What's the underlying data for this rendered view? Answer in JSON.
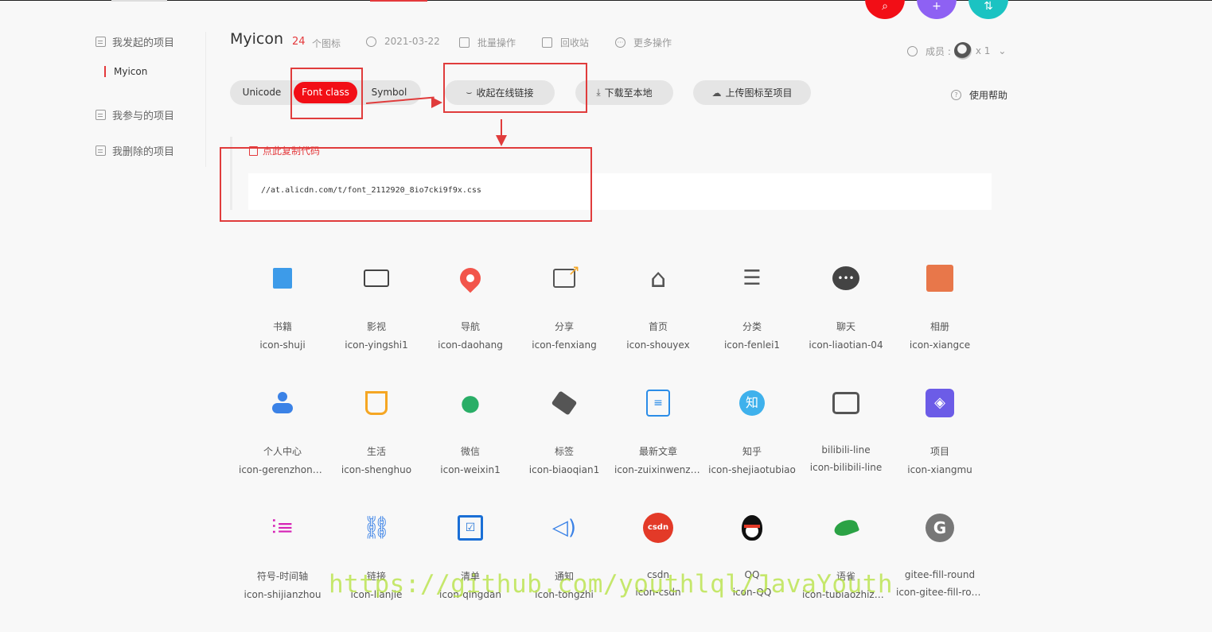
{
  "sidebar": {
    "items": [
      {
        "label": "我发起的项目"
      },
      {
        "label": "我参与的项目"
      },
      {
        "label": "我删除的项目"
      }
    ],
    "active_project": "Myicon"
  },
  "header": {
    "title": "Myicon",
    "icon_count": "24",
    "icon_count_label": "个图标",
    "date": "2021-03-22",
    "batch": "批量操作",
    "trash": "回收站",
    "more": "更多操作",
    "members_label": "成员 :",
    "members_count": "x 1"
  },
  "fabs": {
    "search": "⌕",
    "add": "+",
    "sort": "⇅"
  },
  "tabs": [
    {
      "label": "Unicode",
      "active": false
    },
    {
      "label": "Font class",
      "active": true
    },
    {
      "label": "Symbol",
      "active": false
    }
  ],
  "actions": {
    "collapse": "收起在线链接",
    "download": "下载至本地",
    "upload": "上传图标至项目",
    "help": "使用帮助"
  },
  "code": {
    "copy_label": "点此复制代码",
    "url": "//at.alicdn.com/t/font_2112920_8io7cki9f9x.css"
  },
  "icons": [
    {
      "name": "书籍",
      "cls": "icon-shuji",
      "color": "#3d9be9",
      "glyph": "book-icon"
    },
    {
      "name": "影视",
      "cls": "icon-yingshi1",
      "color": "#444444",
      "glyph": "camera-icon"
    },
    {
      "name": "导航",
      "cls": "icon-daohang",
      "color": "#f2554b",
      "glyph": "pin-icon"
    },
    {
      "name": "分享",
      "cls": "icon-fenxiang",
      "color": "#f5a623",
      "glyph": "share-icon"
    },
    {
      "name": "首页",
      "cls": "icon-shouyex",
      "color": "#555555",
      "glyph": "home-icon"
    },
    {
      "name": "分类",
      "cls": "icon-fenlei1",
      "color": "#555555",
      "glyph": "list-icon"
    },
    {
      "name": "聊天",
      "cls": "icon-liaotian-04",
      "color": "#444444",
      "glyph": "chat-icon"
    },
    {
      "name": "相册",
      "cls": "icon-xiangce",
      "color": "#e8774a",
      "glyph": "album-icon"
    },
    {
      "name": "个人中心",
      "cls": "icon-gerenzhongxin",
      "color": "#3b82e6",
      "glyph": "user-icon"
    },
    {
      "name": "生活",
      "cls": "icon-shenghuo",
      "color": "#f5a623",
      "glyph": "cup-icon"
    },
    {
      "name": "微信",
      "cls": "icon-weixin1",
      "color": "#2aae67",
      "glyph": "wechat-icon"
    },
    {
      "name": "标签",
      "cls": "icon-biaoqian1",
      "color": "#555555",
      "glyph": "tag-icon"
    },
    {
      "name": "最新文章",
      "cls": "icon-zuixinwenzhang",
      "color": "#2b8de8",
      "glyph": "article-icon"
    },
    {
      "name": "知乎",
      "cls": "icon-shejiaotubiao",
      "color": "#3fb1ec",
      "glyph": "zhihu-icon"
    },
    {
      "name": "bilibili-line",
      "cls": "icon-bilibili-line",
      "color": "#555555",
      "glyph": "tv-icon"
    },
    {
      "name": "项目",
      "cls": "icon-xiangmu",
      "color": "#6c5ce7",
      "glyph": "layers-icon"
    },
    {
      "name": "符号-时间轴",
      "cls": "icon-shijianzhou",
      "color": "#d622b5",
      "glyph": "timeline-icon"
    },
    {
      "name": "链接",
      "cls": "icon-lianjie",
      "color": "#3b82e6",
      "glyph": "link-icon"
    },
    {
      "name": "清单",
      "cls": "icon-qingdan",
      "color": "#1a6fd6",
      "glyph": "checklist-icon"
    },
    {
      "name": "通知",
      "cls": "icon-tongzhi",
      "color": "#3b82e6",
      "glyph": "speaker-icon"
    },
    {
      "name": "csdn",
      "cls": "icon-csdn",
      "color": "#e33a28",
      "glyph": "csdn-icon"
    },
    {
      "name": "QQ",
      "cls": "icon-QQ",
      "color": "#111111",
      "glyph": "penguin-icon"
    },
    {
      "name": "语雀",
      "cls": "icon-tubiaozhizuomoban",
      "color": "#2ba245",
      "glyph": "bird-icon"
    },
    {
      "name": "gitee-fill-round",
      "cls": "icon-gitee-fill-round",
      "color": "#777777",
      "glyph": "gitee-icon"
    }
  ],
  "watermark": "https://github.com/youthlql/JavaYouth"
}
